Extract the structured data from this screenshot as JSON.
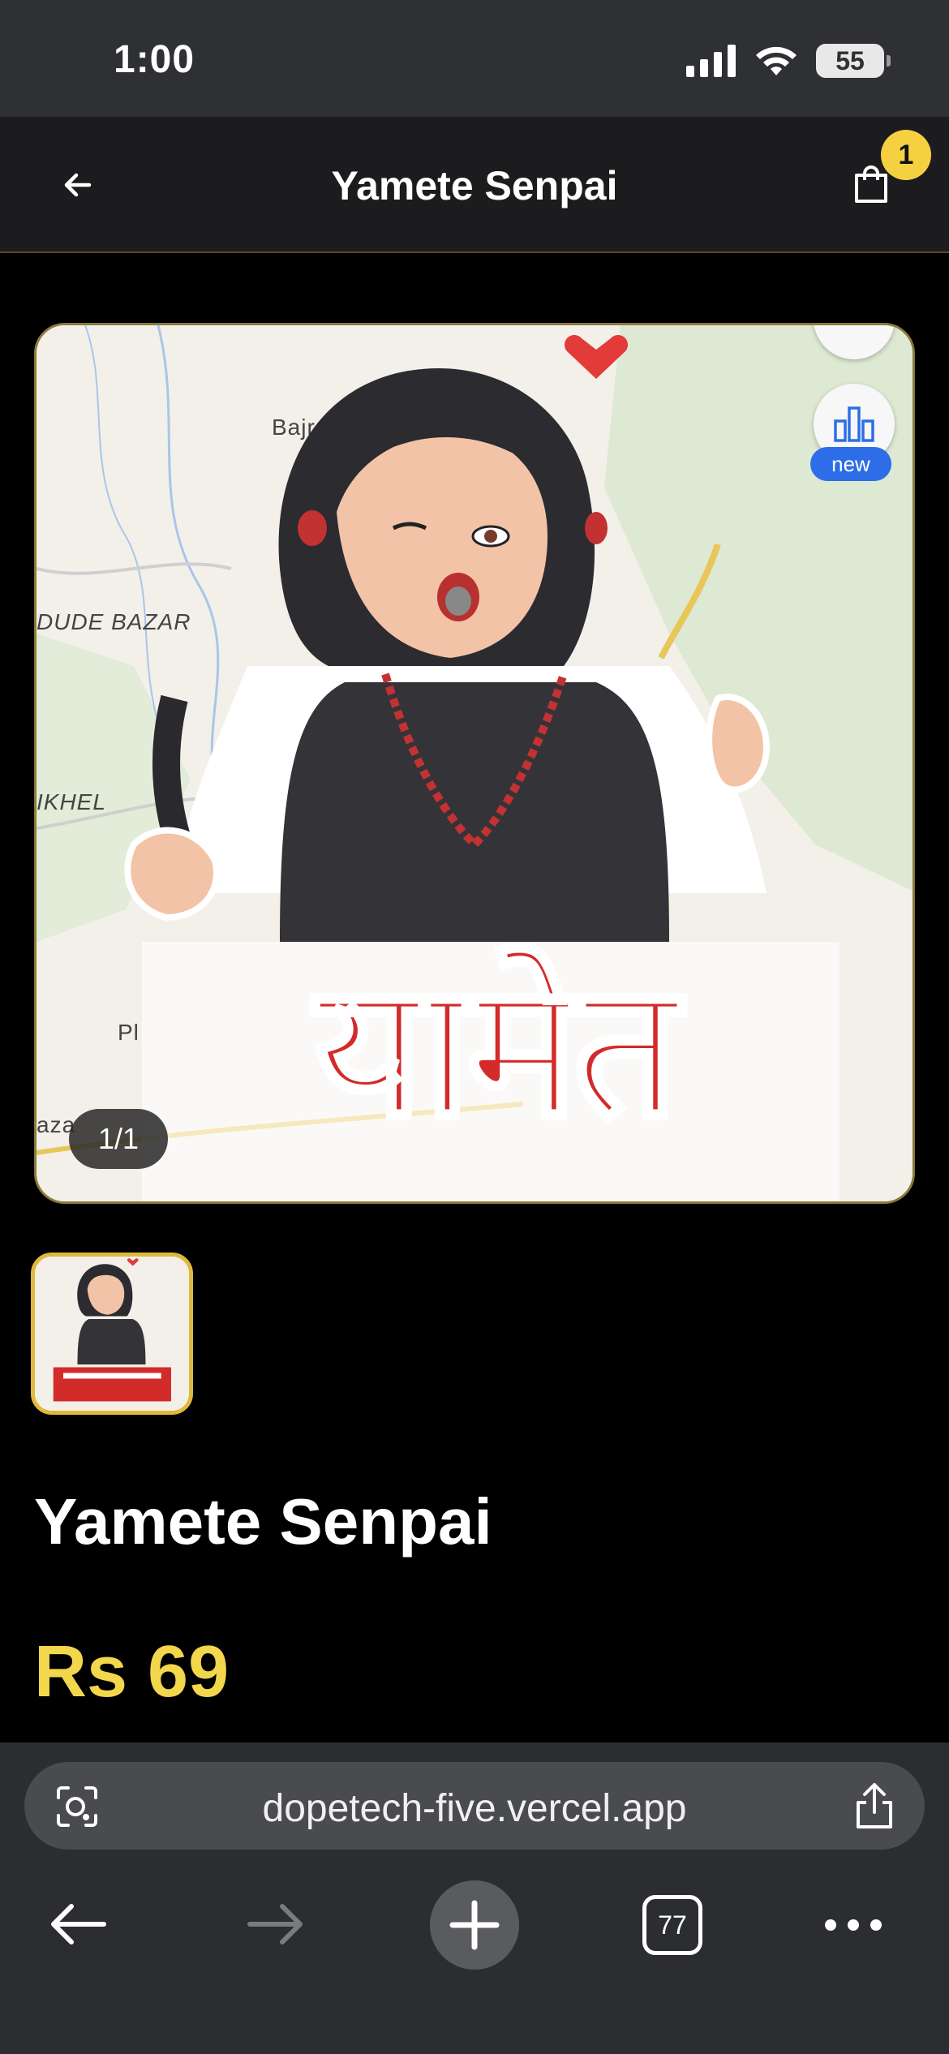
{
  "status_bar": {
    "time": "1:00",
    "battery": "55",
    "icons": [
      "signal-icon",
      "wifi-icon",
      "battery-icon"
    ]
  },
  "header": {
    "title": "Yamete Senpai",
    "cart_count": "1",
    "icons": [
      "back-arrow-icon",
      "shopping-bag-icon"
    ]
  },
  "gallery": {
    "counter": "1/1",
    "map_labels": {
      "bajra": "Bajra",
      "dude_bazar": "DUDE BAZAR",
      "ikhel": "IKHEL",
      "pl": "Pl",
      "aza": "aza"
    },
    "map_new_badge": "new",
    "artwork_caption": "यामेत"
  },
  "product": {
    "name": "Yamete Senpai",
    "price": "Rs 69"
  },
  "browser": {
    "url": "dopetech-five.vercel.app",
    "tab_count": "77",
    "icons": [
      "lens-icon",
      "share-icon",
      "back-arrow-icon",
      "forward-arrow-icon",
      "plus-icon",
      "tabs-icon",
      "more-icon"
    ]
  },
  "colors": {
    "accent": "#f2d64b",
    "badge": "#f5d142",
    "header_bg": "#1c1c1e",
    "page_bg": "#000000",
    "browser_bg": "#2c2d30",
    "map_badge": "#2d6ee8"
  }
}
